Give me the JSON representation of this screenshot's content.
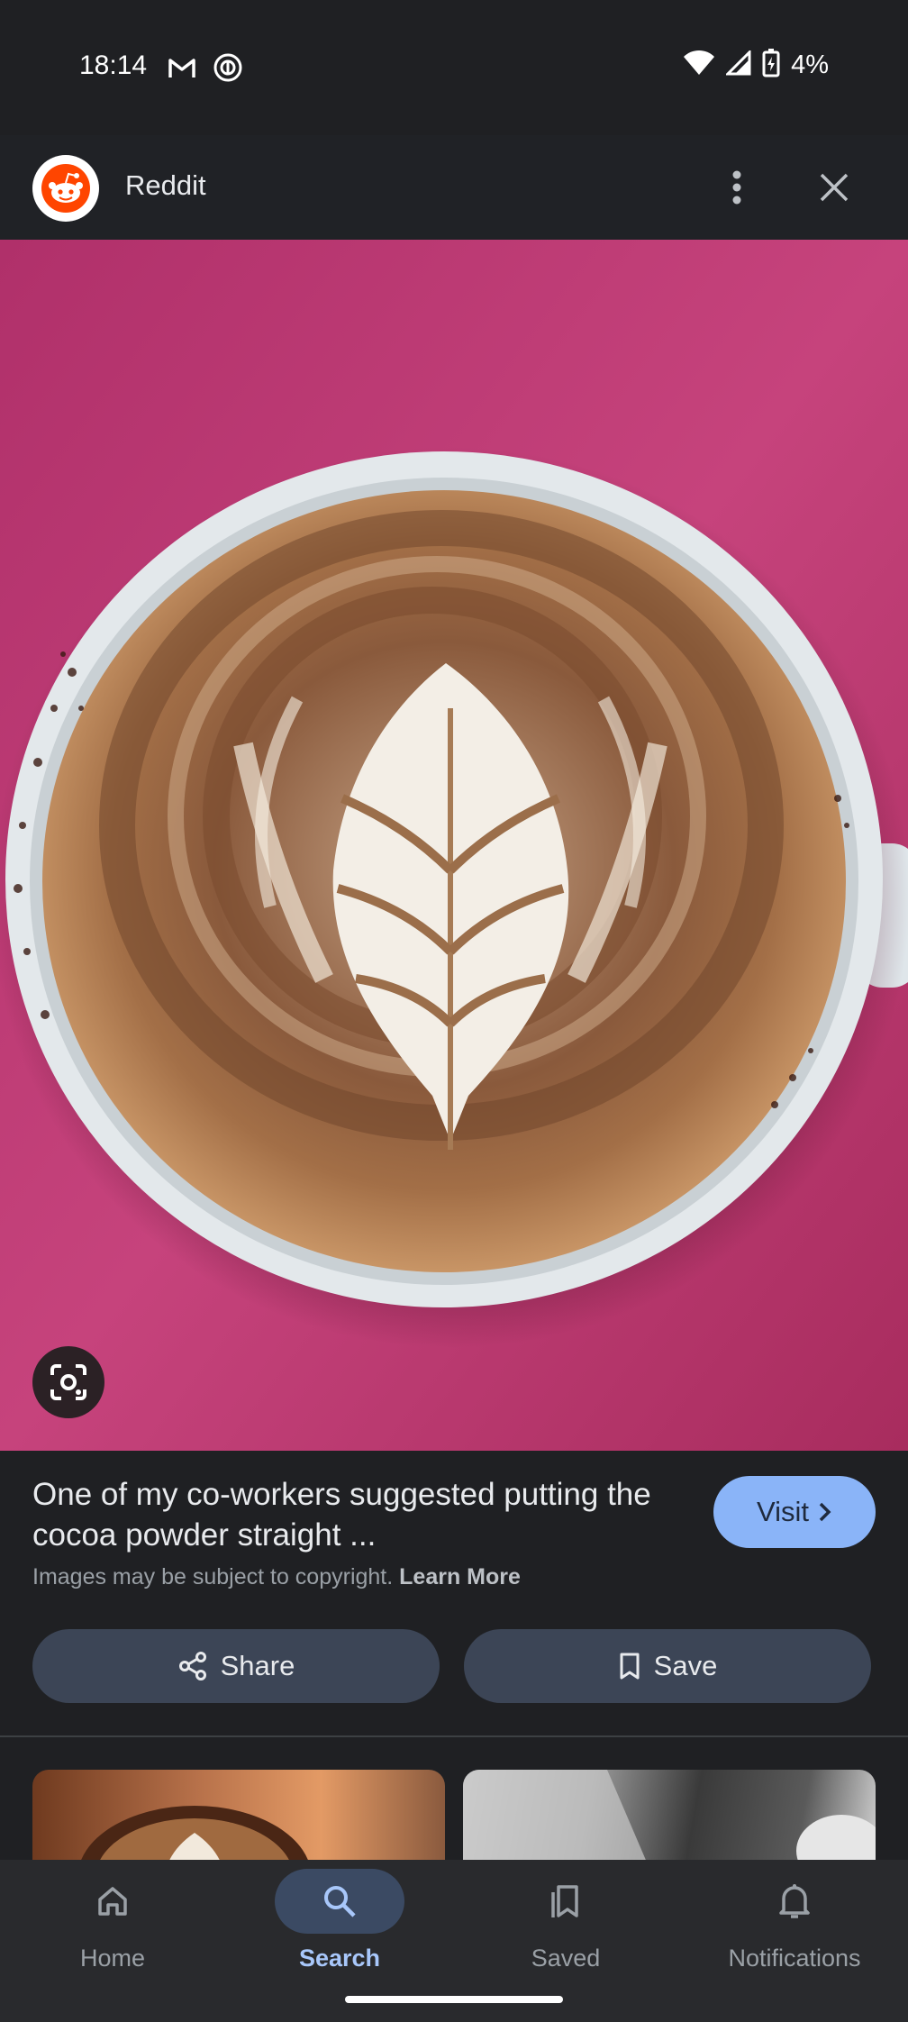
{
  "status_bar": {
    "time": "18:14",
    "battery": "4%",
    "icons": [
      "gmail-icon",
      "at-sign-icon",
      "wifi-icon",
      "signal-icon",
      "battery-charging-icon"
    ]
  },
  "header": {
    "source_name": "Reddit",
    "logo_icon": "reddit-logo-icon",
    "menu_icon": "more-vertical-icon",
    "close_icon": "close-icon"
  },
  "image": {
    "lens_icon": "google-lens-icon"
  },
  "result": {
    "caption": "One of my co-workers suggested putting the cocoa powder straight ...",
    "visit_label": "Visit",
    "copyright_text": "Images may be subject to copyright.",
    "learn_more_label": "Learn More",
    "share_label": "Share",
    "save_label": "Save"
  },
  "bottom_nav": {
    "items": [
      {
        "label": "Home",
        "icon": "home-icon",
        "active": false
      },
      {
        "label": "Search",
        "icon": "search-icon",
        "active": true
      },
      {
        "label": "Saved",
        "icon": "bookmarks-icon",
        "active": false
      },
      {
        "label": "Notifications",
        "icon": "bell-icon",
        "active": false
      }
    ]
  },
  "colors": {
    "background": "#1f2023",
    "accent": "#8ab4f8",
    "active_nav": "#a8c7fa",
    "button_bg": "#3c4556",
    "image_backdrop": "#c43f78"
  }
}
